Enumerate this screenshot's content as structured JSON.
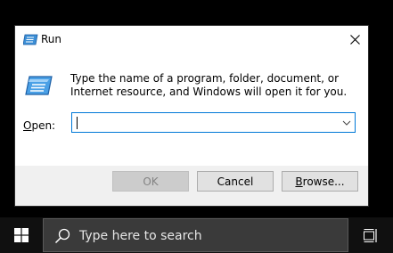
{
  "dialog": {
    "title": "Run",
    "description": "Type the name of a program, folder, document, or Internet resource, and Windows will open it for you.",
    "open_label_accel": "O",
    "open_label_rest": "pen:",
    "input_value": "",
    "buttons": {
      "ok": "OK",
      "cancel": "Cancel",
      "browse_accel": "B",
      "browse_rest": "rowse..."
    }
  },
  "taskbar": {
    "search_placeholder": "Type here to search"
  },
  "icons": {
    "run": "run-icon",
    "close": "close-icon",
    "dropdown": "chevron-down-icon",
    "start": "windows-logo-icon",
    "search": "search-icon",
    "task_view": "task-view-icon"
  },
  "colors": {
    "accent": "#0078d7",
    "taskbar": "#101010",
    "search_box": "#3a3a3a"
  }
}
